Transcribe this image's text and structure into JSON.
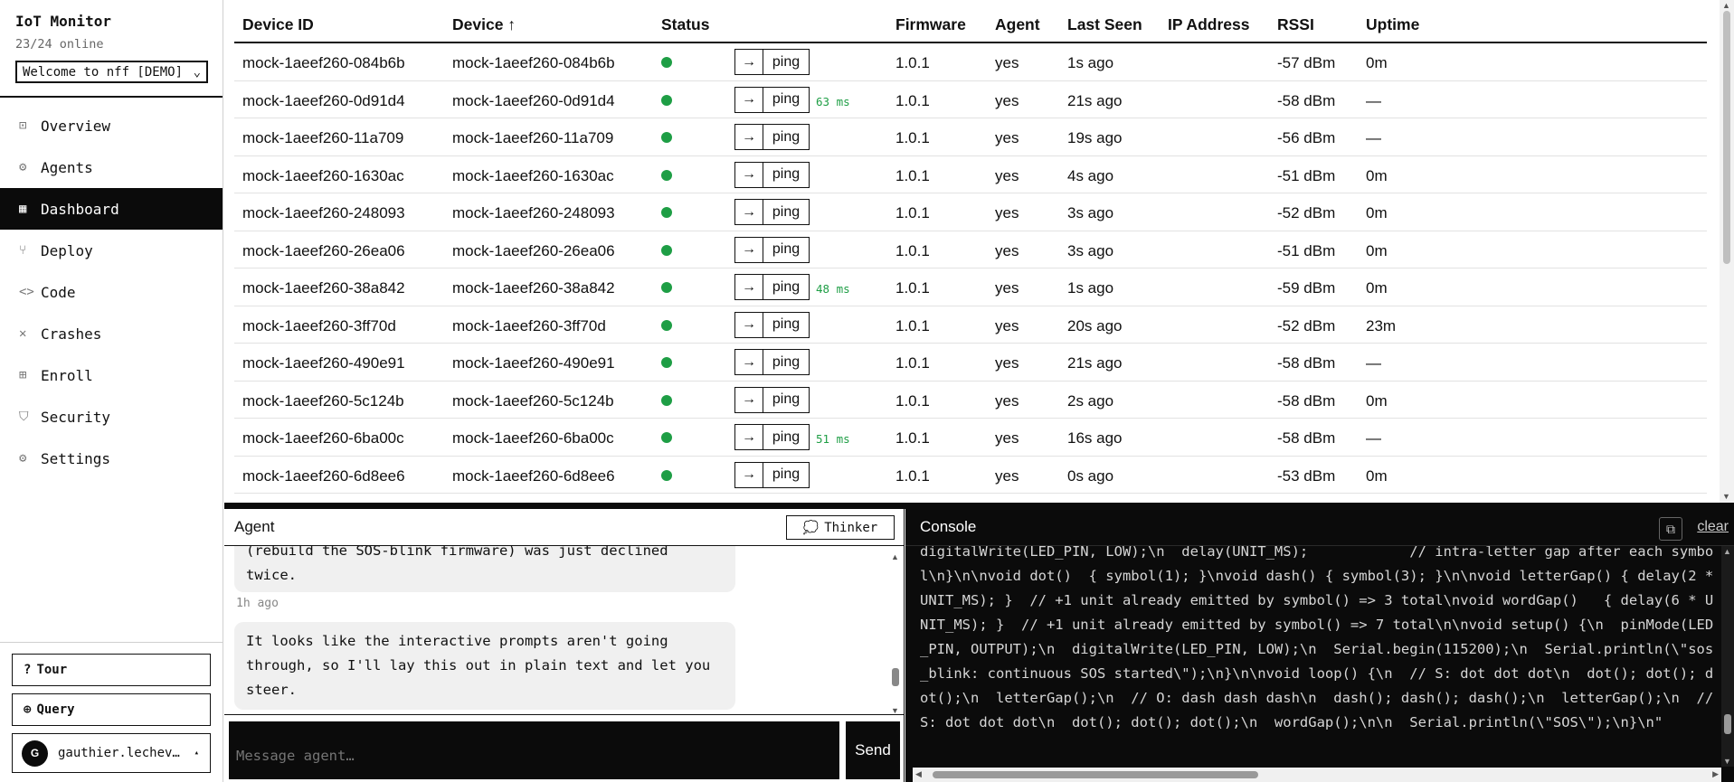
{
  "app": {
    "title": "IoT Monitor",
    "online": "23/24 online",
    "project": "Welcome to nff [DEMO]"
  },
  "nav": [
    {
      "label": "Overview",
      "icon": "square-icon",
      "glyph": "⊡"
    },
    {
      "label": "Agents",
      "icon": "gear-icon",
      "glyph": "⚙"
    },
    {
      "label": "Dashboard",
      "icon": "grid-icon",
      "glyph": "▦"
    },
    {
      "label": "Deploy",
      "icon": "fork-icon",
      "glyph": "⑂"
    },
    {
      "label": "Code",
      "icon": "code-icon",
      "glyph": "<>"
    },
    {
      "label": "Crashes",
      "icon": "cross-icon",
      "glyph": "✕"
    },
    {
      "label": "Enroll",
      "icon": "grid-plus-icon",
      "glyph": "⊞"
    },
    {
      "label": "Security",
      "icon": "shield-icon",
      "glyph": "⛉"
    },
    {
      "label": "Settings",
      "icon": "gear-icon",
      "glyph": "⚙"
    }
  ],
  "active_nav": "Dashboard",
  "bottom": {
    "tour": "Tour",
    "query": "Query",
    "user_initial": "G",
    "user_name": "gauthier.lechev…"
  },
  "table": {
    "headers": {
      "device_id": "Device ID",
      "device": "Device ↑",
      "status": "Status",
      "firmware": "Firmware",
      "agent": "Agent",
      "last_seen": "Last Seen",
      "ip": "IP Address",
      "rssi": "RSSI",
      "uptime": "Uptime"
    },
    "arrow_label": "→",
    "ping_label": "ping",
    "status_color": "#1e9e45",
    "rows": [
      {
        "id": "mock-1aeef260-084b6b",
        "device": "mock-1aeef260-084b6b",
        "latency": "",
        "firmware": "1.0.1",
        "agent": "yes",
        "last_seen": "1s ago",
        "ip": "",
        "rssi": "-57 dBm",
        "uptime": "0m"
      },
      {
        "id": "mock-1aeef260-0d91d4",
        "device": "mock-1aeef260-0d91d4",
        "latency": "63 ms",
        "firmware": "1.0.1",
        "agent": "yes",
        "last_seen": "21s ago",
        "ip": "",
        "rssi": "-58 dBm",
        "uptime": "—"
      },
      {
        "id": "mock-1aeef260-11a709",
        "device": "mock-1aeef260-11a709",
        "latency": "",
        "firmware": "1.0.1",
        "agent": "yes",
        "last_seen": "19s ago",
        "ip": "",
        "rssi": "-56 dBm",
        "uptime": "—"
      },
      {
        "id": "mock-1aeef260-1630ac",
        "device": "mock-1aeef260-1630ac",
        "latency": "",
        "firmware": "1.0.1",
        "agent": "yes",
        "last_seen": "4s ago",
        "ip": "",
        "rssi": "-51 dBm",
        "uptime": "0m"
      },
      {
        "id": "mock-1aeef260-248093",
        "device": "mock-1aeef260-248093",
        "latency": "",
        "firmware": "1.0.1",
        "agent": "yes",
        "last_seen": "3s ago",
        "ip": "",
        "rssi": "-52 dBm",
        "uptime": "0m"
      },
      {
        "id": "mock-1aeef260-26ea06",
        "device": "mock-1aeef260-26ea06",
        "latency": "",
        "firmware": "1.0.1",
        "agent": "yes",
        "last_seen": "3s ago",
        "ip": "",
        "rssi": "-51 dBm",
        "uptime": "0m"
      },
      {
        "id": "mock-1aeef260-38a842",
        "device": "mock-1aeef260-38a842",
        "latency": "48 ms",
        "firmware": "1.0.1",
        "agent": "yes",
        "last_seen": "1s ago",
        "ip": "",
        "rssi": "-59 dBm",
        "uptime": "0m"
      },
      {
        "id": "mock-1aeef260-3ff70d",
        "device": "mock-1aeef260-3ff70d",
        "latency": "",
        "firmware": "1.0.1",
        "agent": "yes",
        "last_seen": "20s ago",
        "ip": "",
        "rssi": "-52 dBm",
        "uptime": "23m"
      },
      {
        "id": "mock-1aeef260-490e91",
        "device": "mock-1aeef260-490e91",
        "latency": "",
        "firmware": "1.0.1",
        "agent": "yes",
        "last_seen": "21s ago",
        "ip": "",
        "rssi": "-58 dBm",
        "uptime": "—"
      },
      {
        "id": "mock-1aeef260-5c124b",
        "device": "mock-1aeef260-5c124b",
        "latency": "",
        "firmware": "1.0.1",
        "agent": "yes",
        "last_seen": "2s ago",
        "ip": "",
        "rssi": "-58 dBm",
        "uptime": "0m"
      },
      {
        "id": "mock-1aeef260-6ba00c",
        "device": "mock-1aeef260-6ba00c",
        "latency": "51 ms",
        "firmware": "1.0.1",
        "agent": "yes",
        "last_seen": "16s ago",
        "ip": "",
        "rssi": "-58 dBm",
        "uptime": "—"
      },
      {
        "id": "mock-1aeef260-6d8ee6",
        "device": "mock-1aeef260-6d8ee6",
        "latency": "",
        "firmware": "1.0.1",
        "agent": "yes",
        "last_seen": "0s ago",
        "ip": "",
        "rssi": "-53 dBm",
        "uptime": "0m"
      }
    ]
  },
  "agent": {
    "title": "Agent",
    "mode": "Thinker",
    "msg1_tail": "(rebuild the SOS-blink firmware) was just declined twice.",
    "msg1_time": "1h ago",
    "msg2": "It looks like the interactive prompts aren't going through, so I'll lay this out in plain text and let you steer.",
    "input_placeholder": "Message agent…",
    "send": "Send"
  },
  "console": {
    "title": "Console",
    "clear": "clear",
    "text": "digitalWrite(LED_PIN, LOW);\\n  delay(UNIT_MS);            // intra-letter gap after each symbol\\n}\\n\\nvoid dot()  { symbol(1); }\\nvoid dash() { symbol(3); }\\n\\nvoid letterGap() { delay(2 * UNIT_MS); }  // +1 unit already emitted by symbol() => 3 total\\nvoid wordGap()   { delay(6 * UNIT_MS); }  // +1 unit already emitted by symbol() => 7 total\\n\\nvoid setup() {\\n  pinMode(LED_PIN, OUTPUT);\\n  digitalWrite(LED_PIN, LOW);\\n  Serial.begin(115200);\\n  Serial.println(\\\"sos_blink: continuous SOS started\\\");\\n}\\n\\nvoid loop() {\\n  // S: dot dot dot\\n  dot(); dot(); dot();\\n  letterGap();\\n  // O: dash dash dash\\n  dash(); dash(); dash();\\n  letterGap();\\n  // S: dot dot dot\\n  dot(); dot(); dot();\\n  wordGap();\\n\\n  Serial.println(\\\"SOS\\\");\\n}\\n\""
  }
}
